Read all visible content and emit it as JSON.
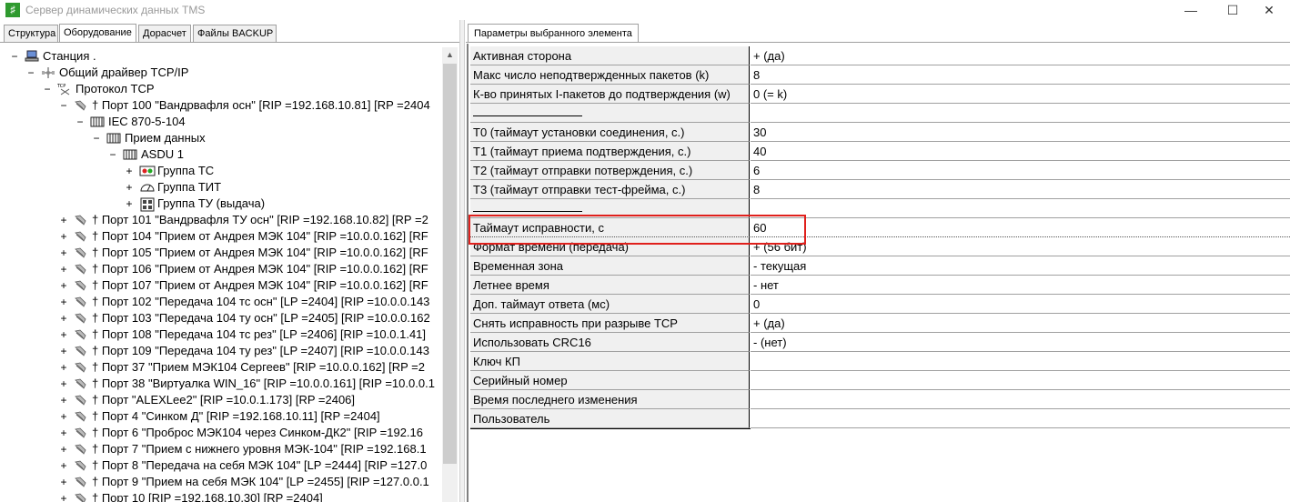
{
  "window": {
    "title": "Сервер динамических данных TMS",
    "app_icon_glyph": "♯"
  },
  "left_tabs": [
    "Структура",
    "Оборудование",
    "Дорасчет",
    "Файлы BACKUP"
  ],
  "left_active_tab": 1,
  "tree": [
    {
      "exp": "−",
      "icon": "computer-icon",
      "label": "Станция ."
    },
    {
      "exp": "−",
      "icon": "network-icon",
      "label": "Общий драйвер TCP/IP"
    },
    {
      "exp": "−",
      "icon": "tcp-protocol-icon",
      "label": "Протокол TCP"
    },
    {
      "exp": "−",
      "icon": "port-icon",
      "label": "† Порт  100 \"Вандрвафля осн\" [RIP =192.168.10.81] [RP =2404"
    },
    {
      "exp": "−",
      "icon": "device-icon",
      "label": "IEC 870-5-104"
    },
    {
      "exp": "−",
      "icon": "device-icon",
      "label": "Прием данных"
    },
    {
      "exp": "−",
      "icon": "device-icon",
      "label": "ASDU  1"
    },
    {
      "exp": "+",
      "icon": "ts-group-icon",
      "label": "Группа ТС"
    },
    {
      "exp": "+",
      "icon": "tit-group-icon",
      "label": "Группа ТИТ"
    },
    {
      "exp": "+",
      "icon": "tu-group-icon",
      "label": "Группа ТУ (выдача)"
    },
    {
      "exp": "+",
      "icon": "port-icon",
      "label": "† Порт  101 \"Вандрвафля ТУ осн\" [RIP =192.168.10.82] [RP =2"
    },
    {
      "exp": "+",
      "icon": "port-icon",
      "label": "† Порт  104 \"Прием от Андрея МЭК 104\" [RIP =10.0.0.162] [RF"
    },
    {
      "exp": "+",
      "icon": "port-icon",
      "label": "† Порт  105 \"Прием от Андрея МЭК 104\" [RIP =10.0.0.162] [RF"
    },
    {
      "exp": "+",
      "icon": "port-icon",
      "label": "† Порт  106 \"Прием от Андрея МЭК 104\" [RIP =10.0.0.162] [RF"
    },
    {
      "exp": "+",
      "icon": "port-icon",
      "label": "† Порт  107 \"Прием от Андрея МЭК 104\" [RIP =10.0.0.162] [RF"
    },
    {
      "exp": "+",
      "icon": "port-icon",
      "label": "† Порт  102 \"Передача 104 тс осн\" [LP =2404] [RIP =10.0.0.143"
    },
    {
      "exp": "+",
      "icon": "port-icon",
      "label": "† Порт  103 \"Передача 104 ту осн\" [LP =2405] [RIP =10.0.0.162"
    },
    {
      "exp": "+",
      "icon": "port-icon",
      "label": "† Порт  108 \"Передача 104 тс рез\" [LP =2406] [RIP =10.0.1.41]"
    },
    {
      "exp": "+",
      "icon": "port-icon",
      "label": "† Порт  109 \"Передача 104 ту рез\" [LP =2407] [RIP =10.0.0.143"
    },
    {
      "exp": "+",
      "icon": "port-icon",
      "label": "† Порт  37 \"Прием МЭК104 Сергеев\" [RIP =10.0.0.162] [RP =2"
    },
    {
      "exp": "+",
      "icon": "port-icon",
      "label": "† Порт  38 \"Виртуалка WIN_16\" [RIP =10.0.0.161] [RIP =10.0.0.1"
    },
    {
      "exp": "+",
      "icon": "port-icon",
      "label": "† Порт  \"ALEXLee2\" [RIP =10.0.1.173] [RP =2406]"
    },
    {
      "exp": "+",
      "icon": "port-icon",
      "label": "† Порт  4 \"Синком Д\" [RIP =192.168.10.11] [RP =2404]"
    },
    {
      "exp": "+",
      "icon": "port-icon",
      "label": "† Порт  6 \"Проброс МЭК104 через Синком-ДК2\" [RIP =192.16"
    },
    {
      "exp": "+",
      "icon": "port-icon",
      "label": "† Порт  7 \"Прием с нижнего уровня МЭК-104\" [RIP =192.168.1"
    },
    {
      "exp": "+",
      "icon": "port-icon",
      "label": "† Порт  8 \"Передача на себя МЭК 104\" [LP =2444] [RIP =127.0"
    },
    {
      "exp": "+",
      "icon": "port-icon",
      "label": "† Порт  9 \"Прием на себя МЭК 104\" [LP =2455] [RIP =127.0.0.1"
    },
    {
      "exp": "+",
      "icon": "port-icon",
      "label": "† Порт  10 [RIP =192.168.10.30] [RP =2404]"
    }
  ],
  "right_tab": "Параметры выбранного элемента",
  "properties": [
    {
      "name": "Активная сторона",
      "value": "+ (да)"
    },
    {
      "name": "Макс число неподтвержденных пакетов (k)",
      "value": "8"
    },
    {
      "name": "К-во принятых I-пакетов до подтверждения (w)",
      "value": "0 (= k)"
    },
    {
      "name": "",
      "value": "",
      "separator": true
    },
    {
      "name": "Т0 (таймаут установки соединения, с.)",
      "value": "30"
    },
    {
      "name": "Т1 (таймаут приема подтверждения, с.)",
      "value": "40"
    },
    {
      "name": "Т2 (таймаут отправки потверждения, с.)",
      "value": "6"
    },
    {
      "name": "Т3 (таймаут отправки тест-фрейма, с.)",
      "value": "8"
    },
    {
      "name": "",
      "value": "",
      "separator": true
    },
    {
      "name": "Таймаут исправности, с",
      "value": "60",
      "selected": true
    },
    {
      "name": "Формат времени (передача)",
      "value": "+ (56 бит)"
    },
    {
      "name": "Временная зона",
      "value": "- текущая"
    },
    {
      "name": "Летнее время",
      "value": "-  нет"
    },
    {
      "name": "Доп. таймаут ответа (мс)",
      "value": "0"
    },
    {
      "name": "Снять исправность при разрыве TCP",
      "value": "+ (да)"
    },
    {
      "name": "Использовать CRC16",
      "value": "-  (нет)"
    },
    {
      "name": "Ключ КП",
      "value": ""
    },
    {
      "name": "Серийный номер",
      "value": ""
    },
    {
      "name": "Время последнего изменения",
      "value": ""
    },
    {
      "name": "Пользователь",
      "value": ""
    }
  ],
  "colors": {
    "highlight_border": "#e0201c",
    "name_cell_bg": "#f0f0f0"
  }
}
